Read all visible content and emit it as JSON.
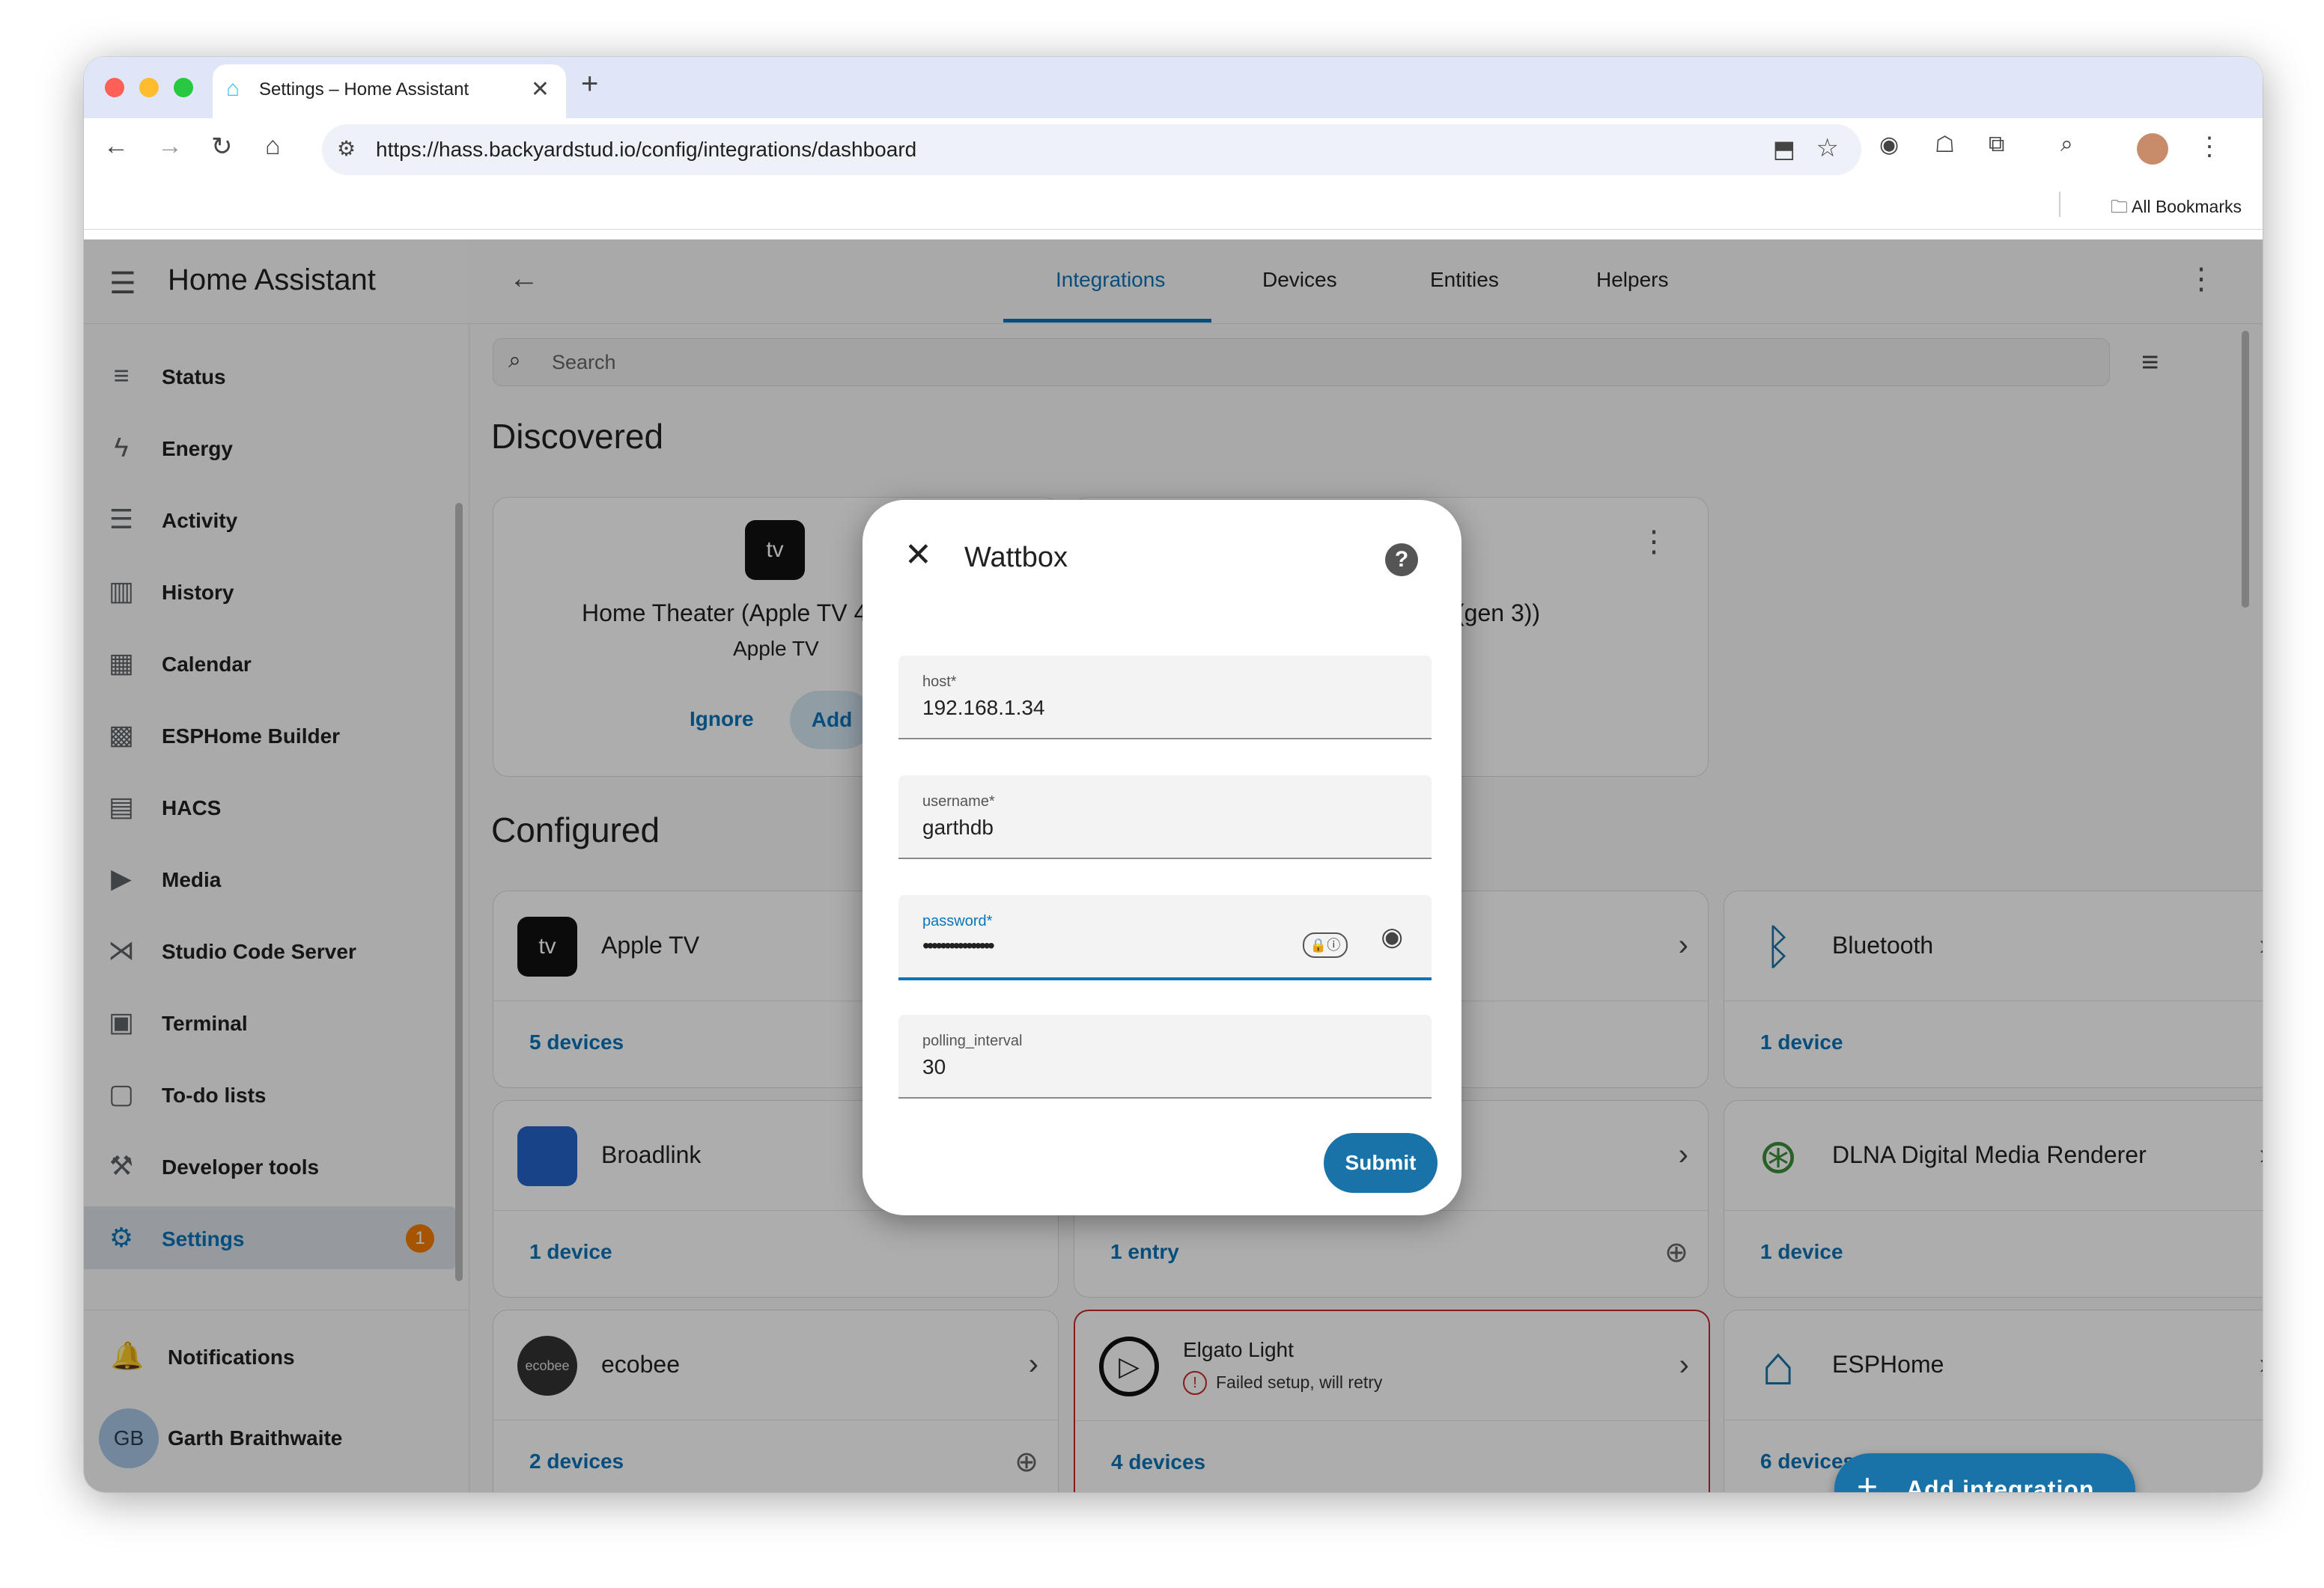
{
  "browser": {
    "tab_title": "Settings – Home Assistant",
    "url": "https://hass.backyardstud.io/config/integrations/dashboard",
    "bookmarks_label": "All Bookmarks"
  },
  "app": {
    "title": "Home Assistant",
    "tabs": [
      "Integrations",
      "Devices",
      "Entities",
      "Helpers"
    ],
    "search_placeholder": "Search"
  },
  "sidebar": {
    "items": [
      {
        "label": "Status",
        "icon": "status-icon"
      },
      {
        "label": "Energy",
        "icon": "lightning-icon"
      },
      {
        "label": "Activity",
        "icon": "list-icon"
      },
      {
        "label": "History",
        "icon": "chart-icon"
      },
      {
        "label": "Calendar",
        "icon": "calendar-icon"
      },
      {
        "label": "ESPHome Builder",
        "icon": "chip-icon"
      },
      {
        "label": "HACS",
        "icon": "hacs-icon"
      },
      {
        "label": "Media",
        "icon": "media-icon"
      },
      {
        "label": "Studio Code Server",
        "icon": "vscode-icon"
      },
      {
        "label": "Terminal",
        "icon": "terminal-icon"
      },
      {
        "label": "To-do lists",
        "icon": "clipboard-icon"
      },
      {
        "label": "Developer tools",
        "icon": "hammer-icon"
      },
      {
        "label": "Settings",
        "icon": "gear-icon",
        "badge": "1"
      }
    ],
    "notifications_label": "Notifications",
    "user_initials": "GB",
    "user_name": "Garth Braithwaite"
  },
  "discovered": {
    "heading": "Discovered",
    "card1_title": "Home Theater (Apple TV 4",
    "card1_subtitle": "Apple TV",
    "ignore_label": "Ignore",
    "add_label": "Add",
    "card2_title_fragment": "(gen 3))"
  },
  "configured": {
    "heading": "Configured",
    "cards": [
      {
        "name": "Apple TV",
        "footer": "5 devices"
      },
      {
        "name": "Bluetooth",
        "footer": "1 device"
      },
      {
        "name": "Broadlink",
        "footer": "1 device"
      },
      {
        "name": "DLNA Digital Media Renderer",
        "footer": "1 device"
      },
      {
        "name": "ecobee",
        "footer": "2 devices",
        "logo_text": "ecobee"
      },
      {
        "name": "Elgato Light",
        "status": "Failed setup, will retry",
        "footer": "4 devices"
      },
      {
        "name": "ESPHome",
        "footer": "6 devices"
      }
    ],
    "partial_entry_footer": "1 entry"
  },
  "fab_label": "Add integration",
  "dialog": {
    "title": "Wattbox",
    "fields": [
      {
        "label": "host*",
        "value": "192.168.1.34"
      },
      {
        "label": "username*",
        "value": "garthdb"
      },
      {
        "label": "password*",
        "value": "••••••••••••••••"
      },
      {
        "label": "polling_interval",
        "value": "30"
      }
    ],
    "submit_label": "Submit"
  },
  "colors": {
    "accent": "#0b74b8",
    "badge": "#f57c00",
    "error": "#c62828"
  }
}
